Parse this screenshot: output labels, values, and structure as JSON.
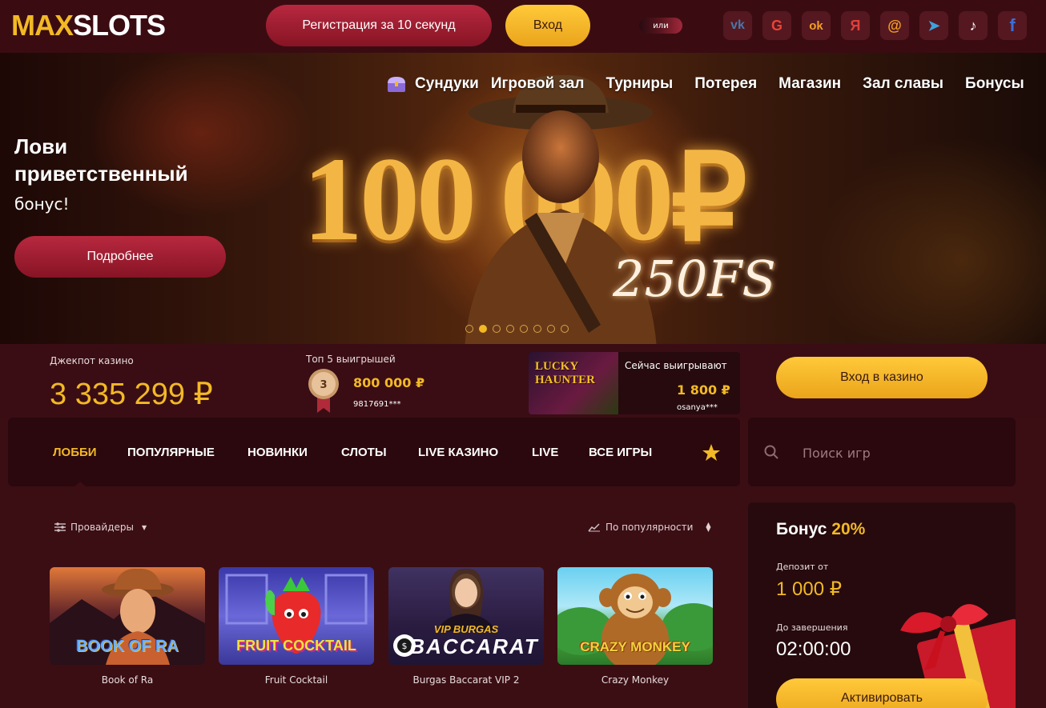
{
  "header": {
    "logo_max": "MAX",
    "logo_slots": "SLOTS",
    "register_label": "Регистрация за 10 секунд",
    "login_label": "Вход",
    "or_label": "или",
    "socials": [
      {
        "name": "vk",
        "glyph": "vk",
        "color": "#4a76a8"
      },
      {
        "name": "google",
        "glyph": "G",
        "color": "#ea4335"
      },
      {
        "name": "odnoklassniki",
        "glyph": "ok",
        "color": "#f2a024"
      },
      {
        "name": "yandex",
        "glyph": "Я",
        "color": "#e0403a"
      },
      {
        "name": "mailru",
        "glyph": "@",
        "color": "#f2a024"
      },
      {
        "name": "telegram",
        "glyph": "➤",
        "color": "#3fa1dc"
      },
      {
        "name": "tiktok",
        "glyph": "♪",
        "color": "#ffffff"
      },
      {
        "name": "facebook",
        "glyph": "f",
        "color": "#3b6ed8"
      }
    ]
  },
  "nav": {
    "items": [
      "Сундуки",
      "Игровой зал",
      "Турниры",
      "Потерея",
      "Магазин",
      "Зал славы",
      "Бонусы"
    ]
  },
  "hero": {
    "title": "Лови приветственный",
    "subtitle": "бонус!",
    "more_label": "Подробнее",
    "big_text": "100 000₽",
    "fs_text": "250FS",
    "slides": 8,
    "active_slide": 2
  },
  "info": {
    "jackpot_label": "Джекпот казино",
    "jackpot_value": "3 335 299 ₽",
    "top5_label": "Топ 5 выигрышей",
    "top5_rank": "3",
    "top5_amount": "800 000 ₽",
    "top5_user": "9817691***",
    "now_label": "Сейчас выигрывают",
    "now_game_text": "LUCKY HAUNTER",
    "now_amount": "1 800 ₽",
    "now_user": "osanya***",
    "casino_login_label": "Вход в казино"
  },
  "tabs": {
    "items": [
      "ЛОББИ",
      "ПОПУЛЯРНЫЕ",
      "НОВИНКИ",
      "СЛОТЫ",
      "LIVE КАЗИНО",
      "LIVE",
      "ВСЕ ИГРЫ"
    ],
    "active": "ЛОББИ"
  },
  "search": {
    "placeholder": "Поиск игр"
  },
  "filters": {
    "providers_label": "Провайдеры",
    "sort_label": "По популярности"
  },
  "games": [
    {
      "title": "Book of Ra",
      "thumb_text": "BOOK OF RA"
    },
    {
      "title": "Fruit Cocktail",
      "thumb_text": "FRUIT COCKTAIL"
    },
    {
      "title": "Burgas Baccarat VIP 2",
      "thumb_text_top": "VIP BURGAS",
      "thumb_text": "BACCARAT"
    },
    {
      "title": "Crazy Monkey",
      "thumb_text": "CRAZY MONKEY"
    }
  ],
  "bonus": {
    "title": "Бонус",
    "percent": "20%",
    "deposit_label": "Депозит от",
    "deposit_value": "1 000 ₽",
    "end_label": "До завершения",
    "end_value": "02:00:00",
    "activate_label": "Активировать"
  },
  "colors": {
    "accent": "#f2b925",
    "background": "#3b0e14",
    "primary_button": "#b8283f"
  }
}
